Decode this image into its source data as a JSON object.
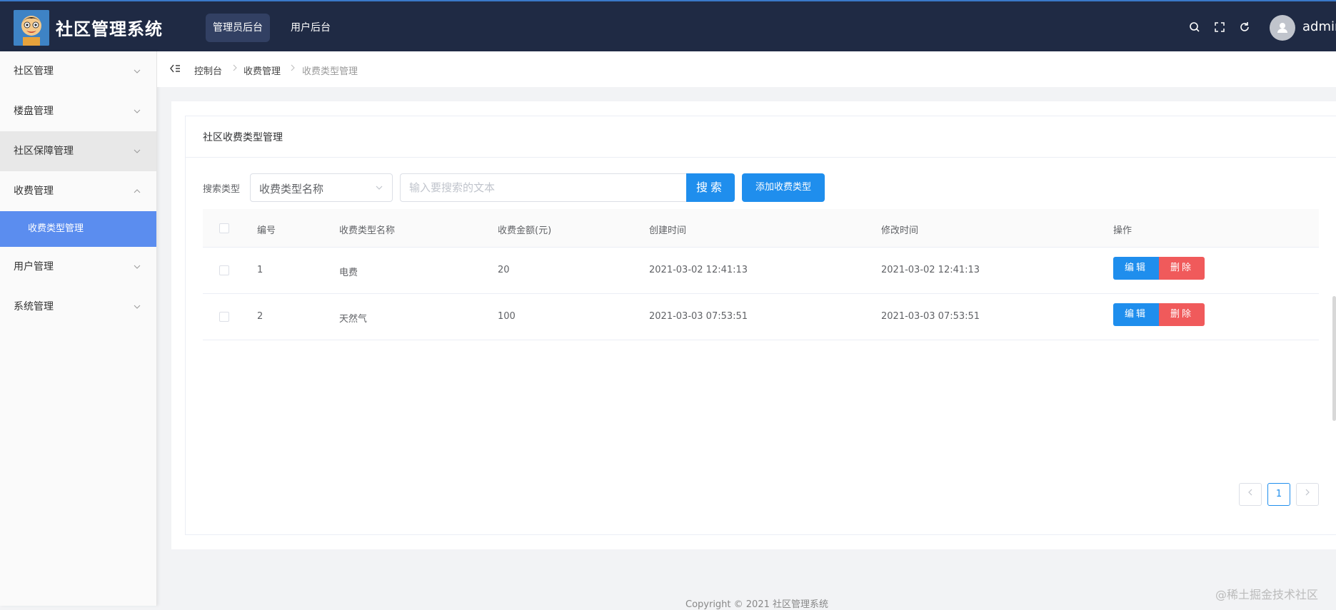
{
  "header": {
    "app_title": "社区管理系统",
    "nav": [
      "管理员后台",
      "用户后台"
    ],
    "username": "admin",
    "icons": [
      "search-icon",
      "fullscreen-icon",
      "refresh-icon"
    ]
  },
  "sidebar": {
    "items": [
      {
        "label": "社区管理"
      },
      {
        "label": "楼盘管理"
      },
      {
        "label": "社区保障管理"
      },
      {
        "label": "收费管理"
      },
      {
        "label": "收费类型管理"
      },
      {
        "label": "用户管理"
      },
      {
        "label": "系统管理"
      }
    ]
  },
  "breadcrumb": [
    "控制台",
    "收费管理",
    "收费类型管理"
  ],
  "card": {
    "title": "社区收费类型管理"
  },
  "search": {
    "label": "搜索类型",
    "select_value": "收费类型名称",
    "placeholder": "输入要搜索的文本",
    "button": "搜索",
    "add_button": "添加收费类型"
  },
  "table": {
    "headers": [
      "编号",
      "收费类型名称",
      "收费金额(元)",
      "创建时间",
      "修改时间",
      "操作"
    ],
    "rows": [
      {
        "id": "1",
        "name": "电费",
        "amount": "20",
        "created": "2021-03-02 12:41:13",
        "modified": "2021-03-02 12:41:13"
      },
      {
        "id": "2",
        "name": "天然气",
        "amount": "100",
        "created": "2021-03-03 07:53:51",
        "modified": "2021-03-03 07:53:51"
      }
    ],
    "edit_label": "编辑",
    "delete_label": "删除"
  },
  "pagination": {
    "current": "1"
  },
  "footer": {
    "copyright": "Copyright © 2021 社区管理系统"
  },
  "watermark": "@稀土掘金技术社区",
  "colors": {
    "header_bg": "#1f2a44",
    "primary": "#1f8eed",
    "danger": "#f05a5b",
    "menu_active": "#5b8def"
  }
}
